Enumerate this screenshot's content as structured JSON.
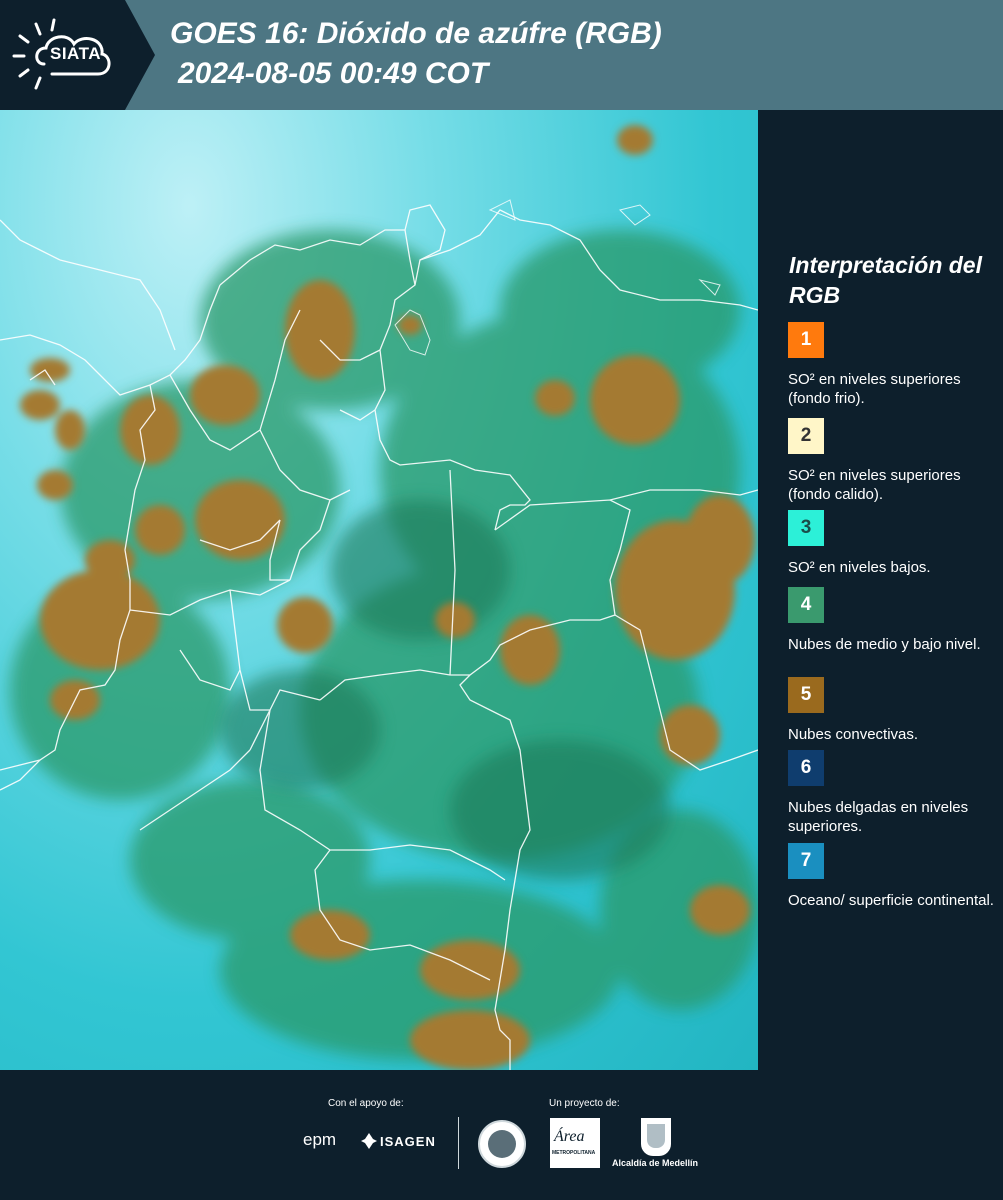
{
  "header": {
    "logo_text": "SIATA",
    "title": "GOES 16: Dióxido de azúfre (RGB)",
    "subtitle": "2024-08-05 00:49 COT"
  },
  "legend": {
    "title": "Interpretación del RGB",
    "items": [
      {
        "num": "1",
        "label": "SO² en niveles superiores (fondo frio).",
        "color": "#ff7a0d",
        "text_color": "#ffffff"
      },
      {
        "num": "2",
        "label": "SO² en niveles superiores (fondo calido).",
        "color": "#fff6c8",
        "text_color": "#333333"
      },
      {
        "num": "3",
        "label": "SO² en niveles bajos.",
        "color": "#2cf0d8",
        "text_color": "#1a4d4a"
      },
      {
        "num": "4",
        "label": "Nubes de medio y bajo nivel.",
        "color": "#3a9a6e",
        "text_color": "#ffffff"
      },
      {
        "num": "5",
        "label": "Nubes convectivas.",
        "color": "#9a6a1e",
        "text_color": "#ffffff"
      },
      {
        "num": "6",
        "label": "Nubes delgadas en niveles superiores.",
        "color": "#0f3d6e",
        "text_color": "#ffffff"
      },
      {
        "num": "7",
        "label": "Oceano/ superficie continental.",
        "color": "#1a8fc0",
        "text_color": "#ffffff"
      }
    ]
  },
  "footer": {
    "support_label": "Con el apoyo de:",
    "project_label": "Un proyecto de:",
    "sponsor_epm": "epm",
    "sponsor_isagen": "ISAGEN",
    "amva_name": "Área",
    "amva_sub": "METROPOLITANA",
    "alcaldia": "Alcaldía de Medellín"
  }
}
